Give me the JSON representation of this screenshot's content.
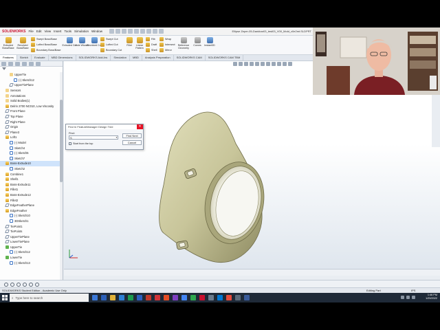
{
  "app": {
    "logo": "SOLIDWORKS",
    "menu": [
      "File",
      "Edit",
      "View",
      "Insert",
      "Tools",
      "Simulation",
      "Window"
    ],
    "doc_title": "Ellipse Zeper-05-Dankbar03_test03_V00_Mold_v0e2mt.SLDPRT"
  },
  "ribbon": {
    "big_buttons": [
      "Extruded Boss/Base",
      "Revolved Boss/Base",
      "Extruded Cut",
      "Hole Wizard",
      "Revolved Cut",
      "Fillet",
      "Linear Pattern",
      "Reference Geometry",
      "Curves",
      "Instant3D"
    ],
    "small_group1": [
      "Swept Boss/Base",
      "Lofted Boss/Base",
      "Boundary Boss/Base"
    ],
    "small_group2": [
      "Swept Cut",
      "Lofted Cut",
      "Boundary Cut"
    ],
    "small_group3": [
      "Rib",
      "Draft",
      "Shell"
    ],
    "small_group4": [
      "Wrap",
      "Intersect",
      "Mirror"
    ]
  },
  "tabs": [
    "Features",
    "Sketch",
    "Evaluate",
    "MBD Dimensions",
    "SOLIDWORKS Add-Ins",
    "Simulation",
    "MBD",
    "Analysis Preparation",
    "SOLIDWORKS CAM",
    "SOLIDWORKS CAM TBM"
  ],
  "tree": [
    {
      "label": "UpperTie",
      "kind": "folder",
      "indent": 2
    },
    {
      "label": "(-) Sketch12",
      "kind": "sketch",
      "indent": 3
    },
    {
      "label": "UpperTiePlane",
      "kind": "plane",
      "indent": 2
    },
    {
      "label": "Sensors",
      "kind": "folder",
      "indent": 1
    },
    {
      "label": "Annotations",
      "kind": "folder",
      "indent": 1
    },
    {
      "label": "Solid Bodies(1)",
      "kind": "folder",
      "indent": 1
    },
    {
      "label": "Delrin 2700 NC010, Low Viscosity",
      "kind": "feat",
      "indent": 1
    },
    {
      "label": "Front Plane",
      "kind": "plane",
      "indent": 1
    },
    {
      "label": "Top Plane",
      "kind": "plane",
      "indent": 1
    },
    {
      "label": "Right Plane",
      "kind": "plane",
      "indent": 1
    },
    {
      "label": "Origin",
      "kind": "plane",
      "indent": 1
    },
    {
      "label": "Plane3",
      "kind": "plane",
      "indent": 1
    },
    {
      "label": "Loft1",
      "kind": "feat",
      "indent": 1
    },
    {
      "label": "(-) Model",
      "kind": "sketch",
      "indent": 2
    },
    {
      "label": "Sketch4",
      "kind": "sketch",
      "indent": 2
    },
    {
      "label": "(-) Sketch5",
      "kind": "sketch",
      "indent": 2
    },
    {
      "label": "Sketch7",
      "kind": "sketch",
      "indent": 2
    },
    {
      "label": "Boss-Extrude10",
      "kind": "feat",
      "indent": 1,
      "sel": true
    },
    {
      "label": "Sketch2",
      "kind": "sketch",
      "indent": 2
    },
    {
      "label": "Combine1",
      "kind": "feat",
      "indent": 1
    },
    {
      "label": "Shell1",
      "kind": "feat",
      "indent": 1
    },
    {
      "label": "Boss-Extrude11",
      "kind": "feat",
      "indent": 1
    },
    {
      "label": "Fillet1",
      "kind": "feat",
      "indent": 1
    },
    {
      "label": "Boss-Extrude12",
      "kind": "feat",
      "indent": 1
    },
    {
      "label": "Fillet2",
      "kind": "feat",
      "indent": 1
    },
    {
      "label": "EdgeFeatherPlane",
      "kind": "plane",
      "indent": 1
    },
    {
      "label": "EdgeFeather",
      "kind": "feat",
      "indent": 1
    },
    {
      "label": "(-) Sketch10",
      "kind": "sketch",
      "indent": 2
    },
    {
      "label": "3DSketch1",
      "kind": "sketch",
      "indent": 2
    },
    {
      "label": "TiePoint1",
      "kind": "plane",
      "indent": 1
    },
    {
      "label": "TiePoints",
      "kind": "plane",
      "indent": 1
    },
    {
      "label": "UpperTiePlane",
      "kind": "plane",
      "indent": 1
    },
    {
      "label": "LowerTiePlane",
      "kind": "plane",
      "indent": 1
    },
    {
      "label": "UpperTie",
      "kind": "green",
      "indent": 1
    },
    {
      "label": "(-) Sketch12",
      "kind": "sketch",
      "indent": 2
    },
    {
      "label": "LowerTie",
      "kind": "green",
      "indent": 1
    },
    {
      "label": "(-) Sketch13",
      "kind": "sketch",
      "indent": 2
    }
  ],
  "find_dialog": {
    "title": "Find In FeatureManager Design Tree",
    "find_label": "Find:",
    "input_value": "S",
    "checkbox_label": "Start from the top",
    "find_next": "Find Next",
    "cancel": "Cancel"
  },
  "status": {
    "left": "SOLIDWORKS Student Edition - Academic Use Only",
    "mode": "Editing Part",
    "units": "IPS"
  },
  "taskbar": {
    "search_placeholder": "Type here to search",
    "time": "1:46 PM",
    "date": "1/29/2022"
  },
  "colors": {
    "model_fill": "#c8c59a",
    "accent": "#c8102e",
    "taskbar": "#1f2a38"
  }
}
